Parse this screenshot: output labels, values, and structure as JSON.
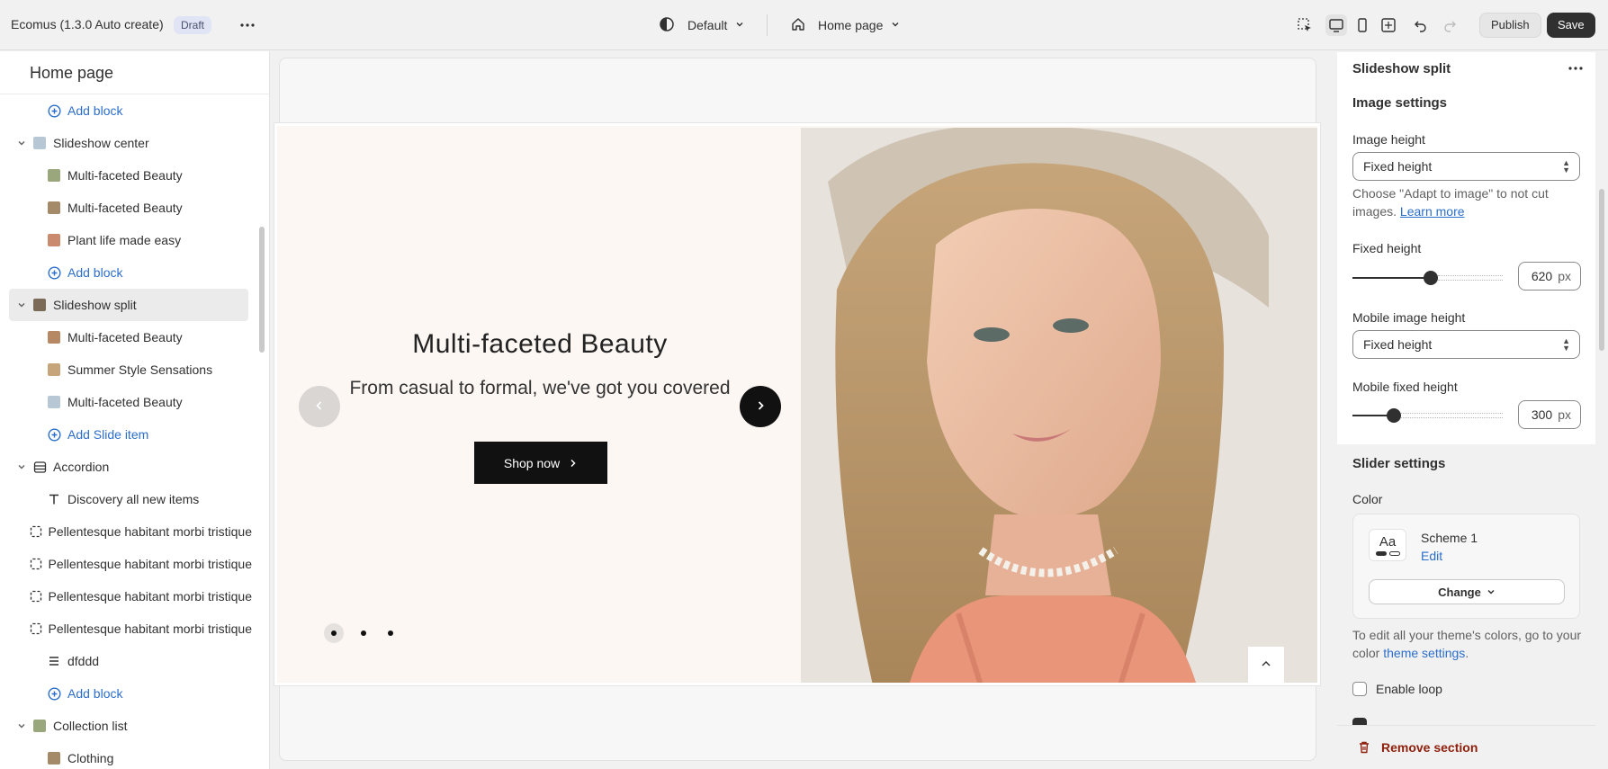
{
  "topbar": {
    "app_title": "Ecomus (1.3.0 Auto create)",
    "status_badge": "Draft",
    "theme_selector": "Default",
    "page_selector": "Home page",
    "publish_label": "Publish",
    "save_label": "Save"
  },
  "sidebar": {
    "title": "Home page",
    "rows": [
      {
        "label": "Add block",
        "kind": "add"
      },
      {
        "label": "Slideshow center",
        "kind": "section"
      },
      {
        "label": "Multi-faceted Beauty",
        "kind": "child"
      },
      {
        "label": "Multi-faceted Beauty",
        "kind": "child"
      },
      {
        "label": "Plant life made easy",
        "kind": "child"
      },
      {
        "label": "Add block",
        "kind": "add"
      },
      {
        "label": "Slideshow split",
        "kind": "section",
        "selected": true
      },
      {
        "label": "Multi-faceted Beauty",
        "kind": "child"
      },
      {
        "label": "Summer Style Sensations",
        "kind": "child"
      },
      {
        "label": "Multi-faceted Beauty",
        "kind": "child"
      },
      {
        "label": "Add Slide item",
        "kind": "add"
      },
      {
        "label": "Accordion",
        "kind": "section"
      },
      {
        "label": "Discovery all new items",
        "kind": "text-child"
      },
      {
        "label": "Pellentesque habitant morbi tristique",
        "kind": "frame-child"
      },
      {
        "label": "Pellentesque habitant morbi tristique",
        "kind": "frame-child"
      },
      {
        "label": "Pellentesque habitant morbi tristique",
        "kind": "frame-child"
      },
      {
        "label": "Pellentesque habitant morbi tristique",
        "kind": "frame-child"
      },
      {
        "label": "dfddd",
        "kind": "lines-child"
      },
      {
        "label": "Add block",
        "kind": "add"
      },
      {
        "label": "Collection list",
        "kind": "section"
      },
      {
        "label": "Clothing",
        "kind": "child"
      }
    ]
  },
  "slide": {
    "heading": "Multi-faceted Beauty",
    "subheading": "From casual to formal, we've got you covered",
    "cta_label": "Shop now"
  },
  "panel": {
    "section_title": "Slideshow split",
    "image_settings_heading": "Image settings",
    "image_height_label": "Image height",
    "image_height_value": "Fixed height",
    "help_text": "Choose \"Adapt to image\" to not cut images.",
    "learn_more": "Learn more",
    "fixed_height_label": "Fixed height",
    "fixed_height_value": "620",
    "fixed_height_fraction": 0.52,
    "unit": "px",
    "mobile_image_height_label": "Mobile image height",
    "mobile_image_height_value": "Fixed height",
    "mobile_fixed_height_label": "Mobile fixed height",
    "mobile_fixed_height_value": "300",
    "mobile_fixed_height_fraction": 0.25,
    "slider_settings_heading": "Slider settings",
    "color_label": "Color",
    "scheme_name": "Scheme 1",
    "scheme_edit": "Edit",
    "scheme_swatch_text": "Aa",
    "change_label": "Change",
    "theme_note": "To edit all your theme's colors, go to your color",
    "theme_link": "theme settings",
    "enable_loop_label": "Enable loop",
    "remove_section_label": "Remove section"
  },
  "colors": {
    "accent_link": "#2c6ecb",
    "save_bg": "#303030",
    "remove_red": "#8e1f0b",
    "slide_bg": "#fcf7f2"
  }
}
